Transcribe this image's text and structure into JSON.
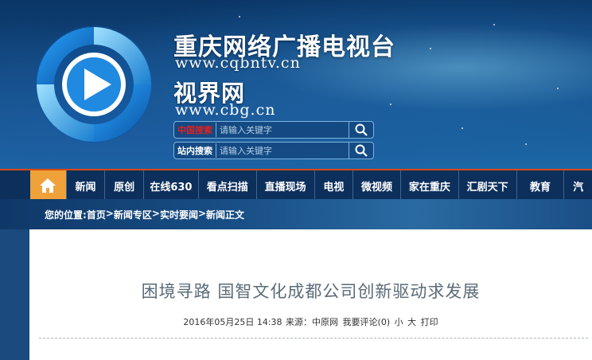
{
  "site": {
    "title": "重庆网络广播电视台",
    "url": "www.cqbntv.cn",
    "subtitle": "视界网",
    "url2": "www.cbg.cn"
  },
  "search": [
    {
      "label": "中国搜索",
      "label_color": "#e02020",
      "placeholder": "请输入关键字"
    },
    {
      "label": "站内搜索",
      "label_color": "#ffffff",
      "placeholder": "请输入关键字"
    }
  ],
  "nav": {
    "home_icon": "home-icon",
    "items": [
      "新闻",
      "原创",
      "在线630",
      "看点扫描",
      "直播现场",
      "电视",
      "微视频",
      "家在重庆",
      "汇剧天下",
      "教育",
      "汽"
    ]
  },
  "breadcrumb": {
    "prefix": "您的位置:",
    "items": [
      "首页",
      "新闻专区",
      "实时要闻",
      "新闻正文"
    ],
    "separator": ">"
  },
  "article": {
    "title": "困境寻路  国智文化成都公司创新驱动求发展",
    "date": "2016年05月25日 14:38",
    "source_label": "来源：",
    "source": "中原网",
    "comment": "我要评论(0)",
    "font_small": "小",
    "font_large": "大",
    "print": "打印"
  },
  "colors": {
    "nav_bg": "#0c2f5c",
    "home_bg": "#f0a23a",
    "accent_line": "#d9480f"
  }
}
